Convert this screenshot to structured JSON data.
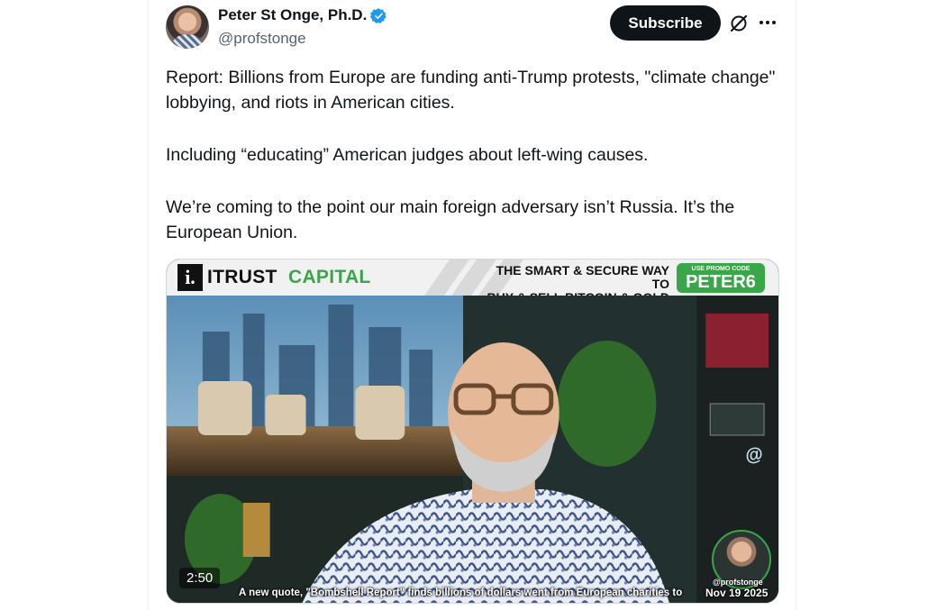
{
  "author": {
    "display_name": "Peter St Onge, Ph.D.",
    "handle": "@profstonge"
  },
  "header": {
    "subscribe_label": "Subscribe",
    "icons": [
      "verified-badge-icon",
      "grok-icon",
      "more-options-icon"
    ]
  },
  "tweet": {
    "paragraphs": [
      "Report: Billions from Europe are funding anti-Trump protests, \"climate change\" lobbying, and riots in American cities.",
      "Including “educating” American judges about left-wing causes.",
      "We’re coming to the point our main foreign adversary isn’t Russia. It’s the European Union."
    ]
  },
  "media": {
    "banner": {
      "logo_mark": "i.",
      "logo_itrust": "ITRUST",
      "logo_capital": "CAPITAL",
      "tagline_line1": "THE SMART & SECURE WAY TO",
      "tagline_line2": "BUY & SELL BITCOIN & GOLD",
      "promo_label": "USE PROMO CODE",
      "promo_code": "PETER6"
    },
    "duration": "2:50",
    "caption": "A new quote, \"Bombshell Report\" finds billions of dollars went from European charities to",
    "corner_handle": "@profstonge",
    "corner_date": "Nov 19 2025",
    "colors": {
      "brand_green": "#3aa64a",
      "verified_blue": "#1d9bf0"
    }
  }
}
